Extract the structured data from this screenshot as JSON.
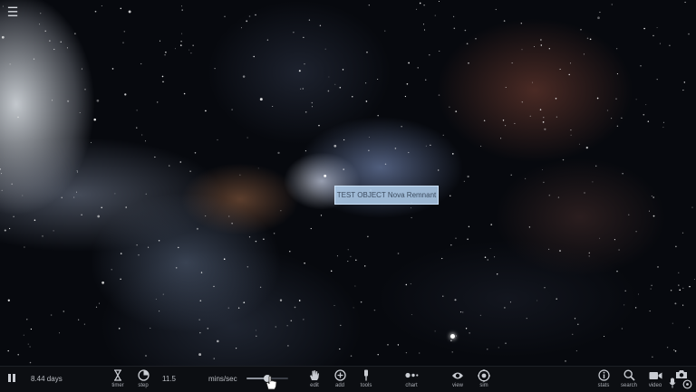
{
  "app": {
    "menu_icon": "hamburger-menu-icon"
  },
  "scene": {
    "object_label": "TEST OBJECT Nova Remnant"
  },
  "toolbar": {
    "pause_icon": "pause-icon",
    "elapsed": "8.44 days",
    "timer_label": "timer",
    "step_label": "step",
    "step_value": "11.5",
    "speed_unit": "mins/sec",
    "speed_level": 0.5,
    "edit_label": "edit",
    "add_label": "add",
    "tools_label": "tools",
    "chart_label": "chart",
    "view_label": "view",
    "sim_label": "sim",
    "stats_label": "stats",
    "search_label": "search",
    "video_label": "video",
    "icons": [
      "hourglass-icon",
      "step-dial-icon",
      "hand-icon",
      "plus-circle-icon",
      "pin-icon",
      "chart-dots-icon",
      "eye-icon",
      "sim-target-icon",
      "info-icon",
      "search-icon",
      "video-camera-icon",
      "microphone-icon",
      "camera-icon",
      "settings-ring-icon"
    ]
  },
  "colors": {
    "toolbar_bg": "#0c0e12",
    "label_bg": "#afcdeb",
    "label_text": "#3c4c60"
  }
}
